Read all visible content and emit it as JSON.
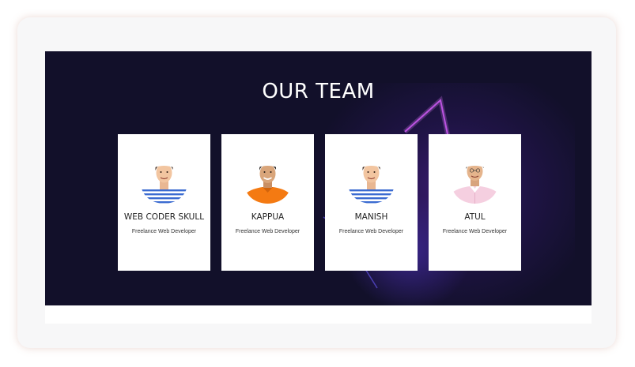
{
  "section": {
    "title": "OUR TEAM"
  },
  "team": [
    {
      "name": "WEB CODER SKULL",
      "role": "Freelance Web Developer",
      "avatar_icon": "man-striped-shirt-avatar"
    },
    {
      "name": "KAPPUA",
      "role": "Freelance Web Developer",
      "avatar_icon": "man-orange-shirt-avatar"
    },
    {
      "name": "MANISH",
      "role": "Freelance Web Developer",
      "avatar_icon": "man-striped-shirt-avatar"
    },
    {
      "name": "ATUL",
      "role": "Freelance Web Developer",
      "avatar_icon": "man-pink-shirt-avatar"
    }
  ],
  "colors": {
    "background": "#12102a",
    "card": "#ffffff",
    "accent_glow": "#7a2fd6"
  }
}
